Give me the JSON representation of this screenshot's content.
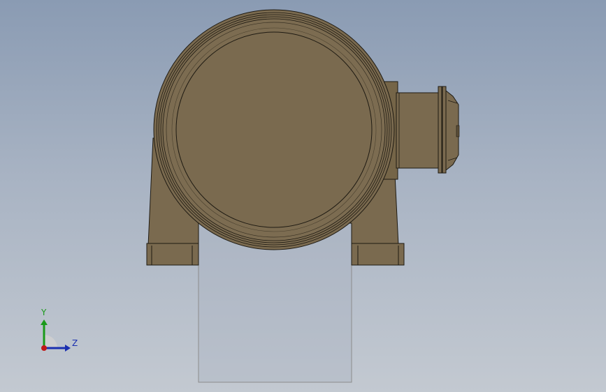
{
  "viewport": {
    "background_top": "#8a9bb3",
    "background_bottom": "#c3c9d1"
  },
  "model": {
    "body_color": "#7a6a4f",
    "edge_color": "#1e1a12",
    "preview_box_color": "#a9b2c0"
  },
  "triad": {
    "y_label": "Y",
    "z_label": "Z",
    "y_color": "#1a9a1a",
    "z_color": "#1a2fb0",
    "x_color": "#c01818"
  }
}
